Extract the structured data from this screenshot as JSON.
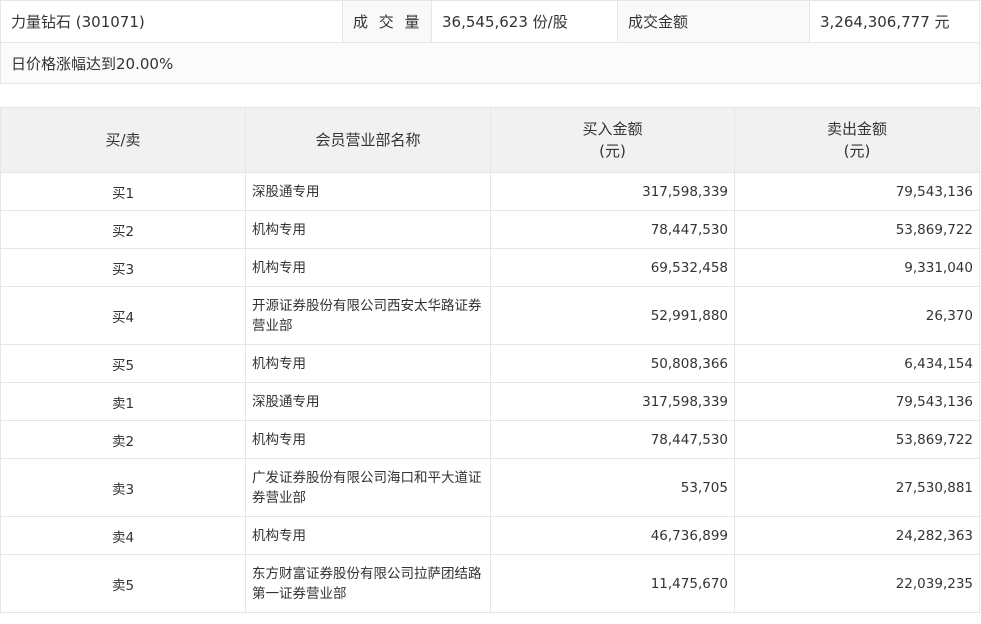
{
  "summary": {
    "stock": "力量钻石 (301071)",
    "volume_label": "成 交 量",
    "volume_value": "36,545,623 份/股",
    "amount_label": "成交金额",
    "amount_value": "3,264,306,777 元",
    "reason": "日价格涨幅达到20.00%"
  },
  "table": {
    "headers": {
      "side": "买/卖",
      "name": "会员营业部名称",
      "buy_line1": "买入金额",
      "buy_line2": "(元)",
      "sell_line1": "卖出金额",
      "sell_line2": "(元)"
    },
    "rows": [
      {
        "side": "买1",
        "name": "深股通专用",
        "buy": "317,598,339",
        "sell": "79,543,136"
      },
      {
        "side": "买2",
        "name": "机构专用",
        "buy": "78,447,530",
        "sell": "53,869,722"
      },
      {
        "side": "买3",
        "name": "机构专用",
        "buy": "69,532,458",
        "sell": "9,331,040"
      },
      {
        "side": "买4",
        "name": "开源证券股份有限公司西安太华路证券营业部",
        "buy": "52,991,880",
        "sell": "26,370"
      },
      {
        "side": "买5",
        "name": "机构专用",
        "buy": "50,808,366",
        "sell": "6,434,154"
      },
      {
        "side": "卖1",
        "name": "深股通专用",
        "buy": "317,598,339",
        "sell": "79,543,136"
      },
      {
        "side": "卖2",
        "name": "机构专用",
        "buy": "78,447,530",
        "sell": "53,869,722"
      },
      {
        "side": "卖3",
        "name": "广发证券股份有限公司海口和平大道证券营业部",
        "buy": "53,705",
        "sell": "27,530,881"
      },
      {
        "side": "卖4",
        "name": "机构专用",
        "buy": "46,736,899",
        "sell": "24,282,363"
      },
      {
        "side": "卖5",
        "name": "东方财富证券股份有限公司拉萨团结路第一证券营业部",
        "buy": "11,475,670",
        "sell": "22,039,235"
      }
    ]
  }
}
